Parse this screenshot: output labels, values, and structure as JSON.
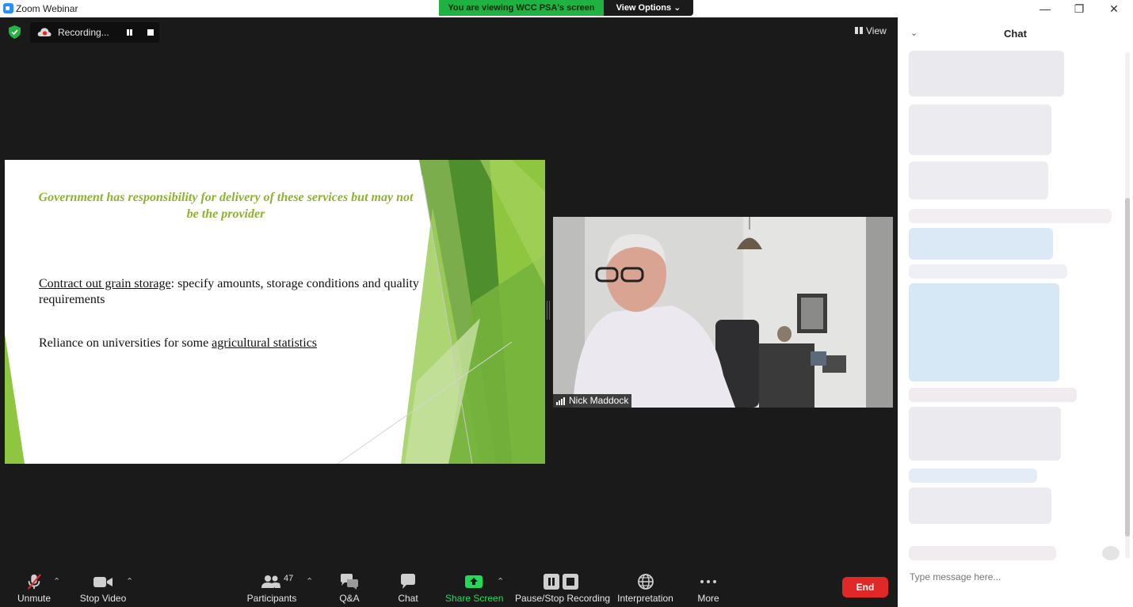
{
  "window": {
    "app_title": "Zoom Webinar",
    "minimize": "—",
    "restore": "❐",
    "close": "✕"
  },
  "share_banner": {
    "viewing_text": "You are viewing WCC PSA's screen",
    "view_options_label": "View Options ⌄"
  },
  "recording": {
    "status_text": "Recording..."
  },
  "view_button": {
    "label": "View"
  },
  "slide": {
    "heading": "Government has responsibility for delivery of these services but may not be the provider",
    "bullet1_link": "Contract out grain storage",
    "bullet1_rest": ": specify amounts, storage conditions and quality requirements",
    "bullet2_prefix": "Reliance on universities for some ",
    "bullet2_link": "agricultural statistics",
    "accent_color": "#8db32e"
  },
  "video": {
    "participant_name": "Nick Maddock"
  },
  "toolbar": {
    "unmute": "Unmute",
    "stop_video": "Stop Video",
    "participants": "Participants",
    "participants_count": "47",
    "qa": "Q&A",
    "chat": "Chat",
    "share_screen": "Share Screen",
    "pause_stop_recording": "Pause/Stop Recording",
    "interpretation": "Interpretation",
    "more": "More",
    "end": "End"
  },
  "chat_panel": {
    "title": "Chat",
    "input_placeholder": "Type message here..."
  },
  "colors": {
    "share_green": "#1fb141",
    "end_red": "#e02828",
    "share_icon_green": "#23d959"
  }
}
